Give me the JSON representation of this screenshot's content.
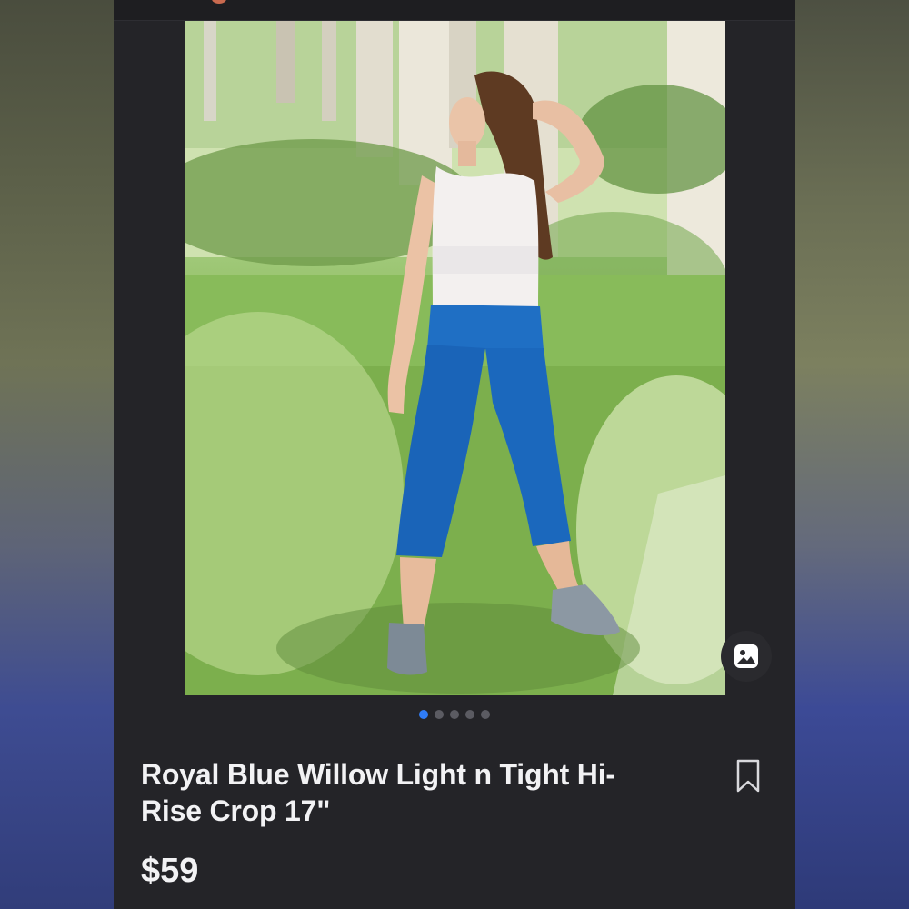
{
  "listing": {
    "title": "Royal Blue Willow Light n Tight Hi-Rise Crop 17\"",
    "price": "$59"
  },
  "photo": {
    "icon": "product-photo"
  },
  "carousel": {
    "page_count": 5,
    "active_page": 1
  },
  "icons": {
    "gallery": "image-icon",
    "bookmark": "bookmark-icon"
  },
  "colors": {
    "background": "#242428",
    "text": "#f2f2f4",
    "pager_active": "#2f7cf6",
    "pager_inactive": "#5b5b62",
    "leggings": "#1f6fc4"
  }
}
